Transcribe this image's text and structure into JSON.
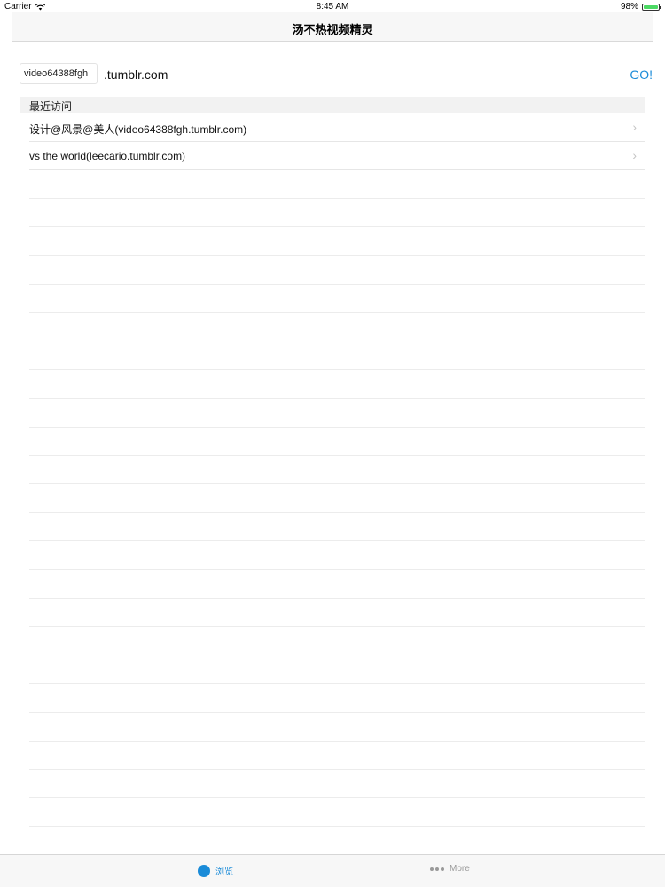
{
  "status": {
    "carrier": "Carrier",
    "time": "8:45 AM",
    "battery_text": "98%",
    "battery_level": 0.98
  },
  "nav": {
    "title": "汤不热视频精灵"
  },
  "input": {
    "domain_value": "video64388fgh",
    "suffix": ".tumblr.com",
    "go_label": "GO!"
  },
  "recent": {
    "header": "最近访问",
    "items": [
      {
        "label": "设计@风景@美人(video64388fgh.tumblr.com)"
      },
      {
        "label": "vs the world(leecario.tumblr.com)"
      }
    ]
  },
  "tabbar": {
    "tabs": [
      {
        "label": "浏览",
        "icon": "circle-icon",
        "active": true
      },
      {
        "label": "More",
        "icon": "more-dots-icon",
        "active": false
      }
    ]
  },
  "colors": {
    "accent": "#1a8bd8",
    "battery": "#4cd964"
  }
}
